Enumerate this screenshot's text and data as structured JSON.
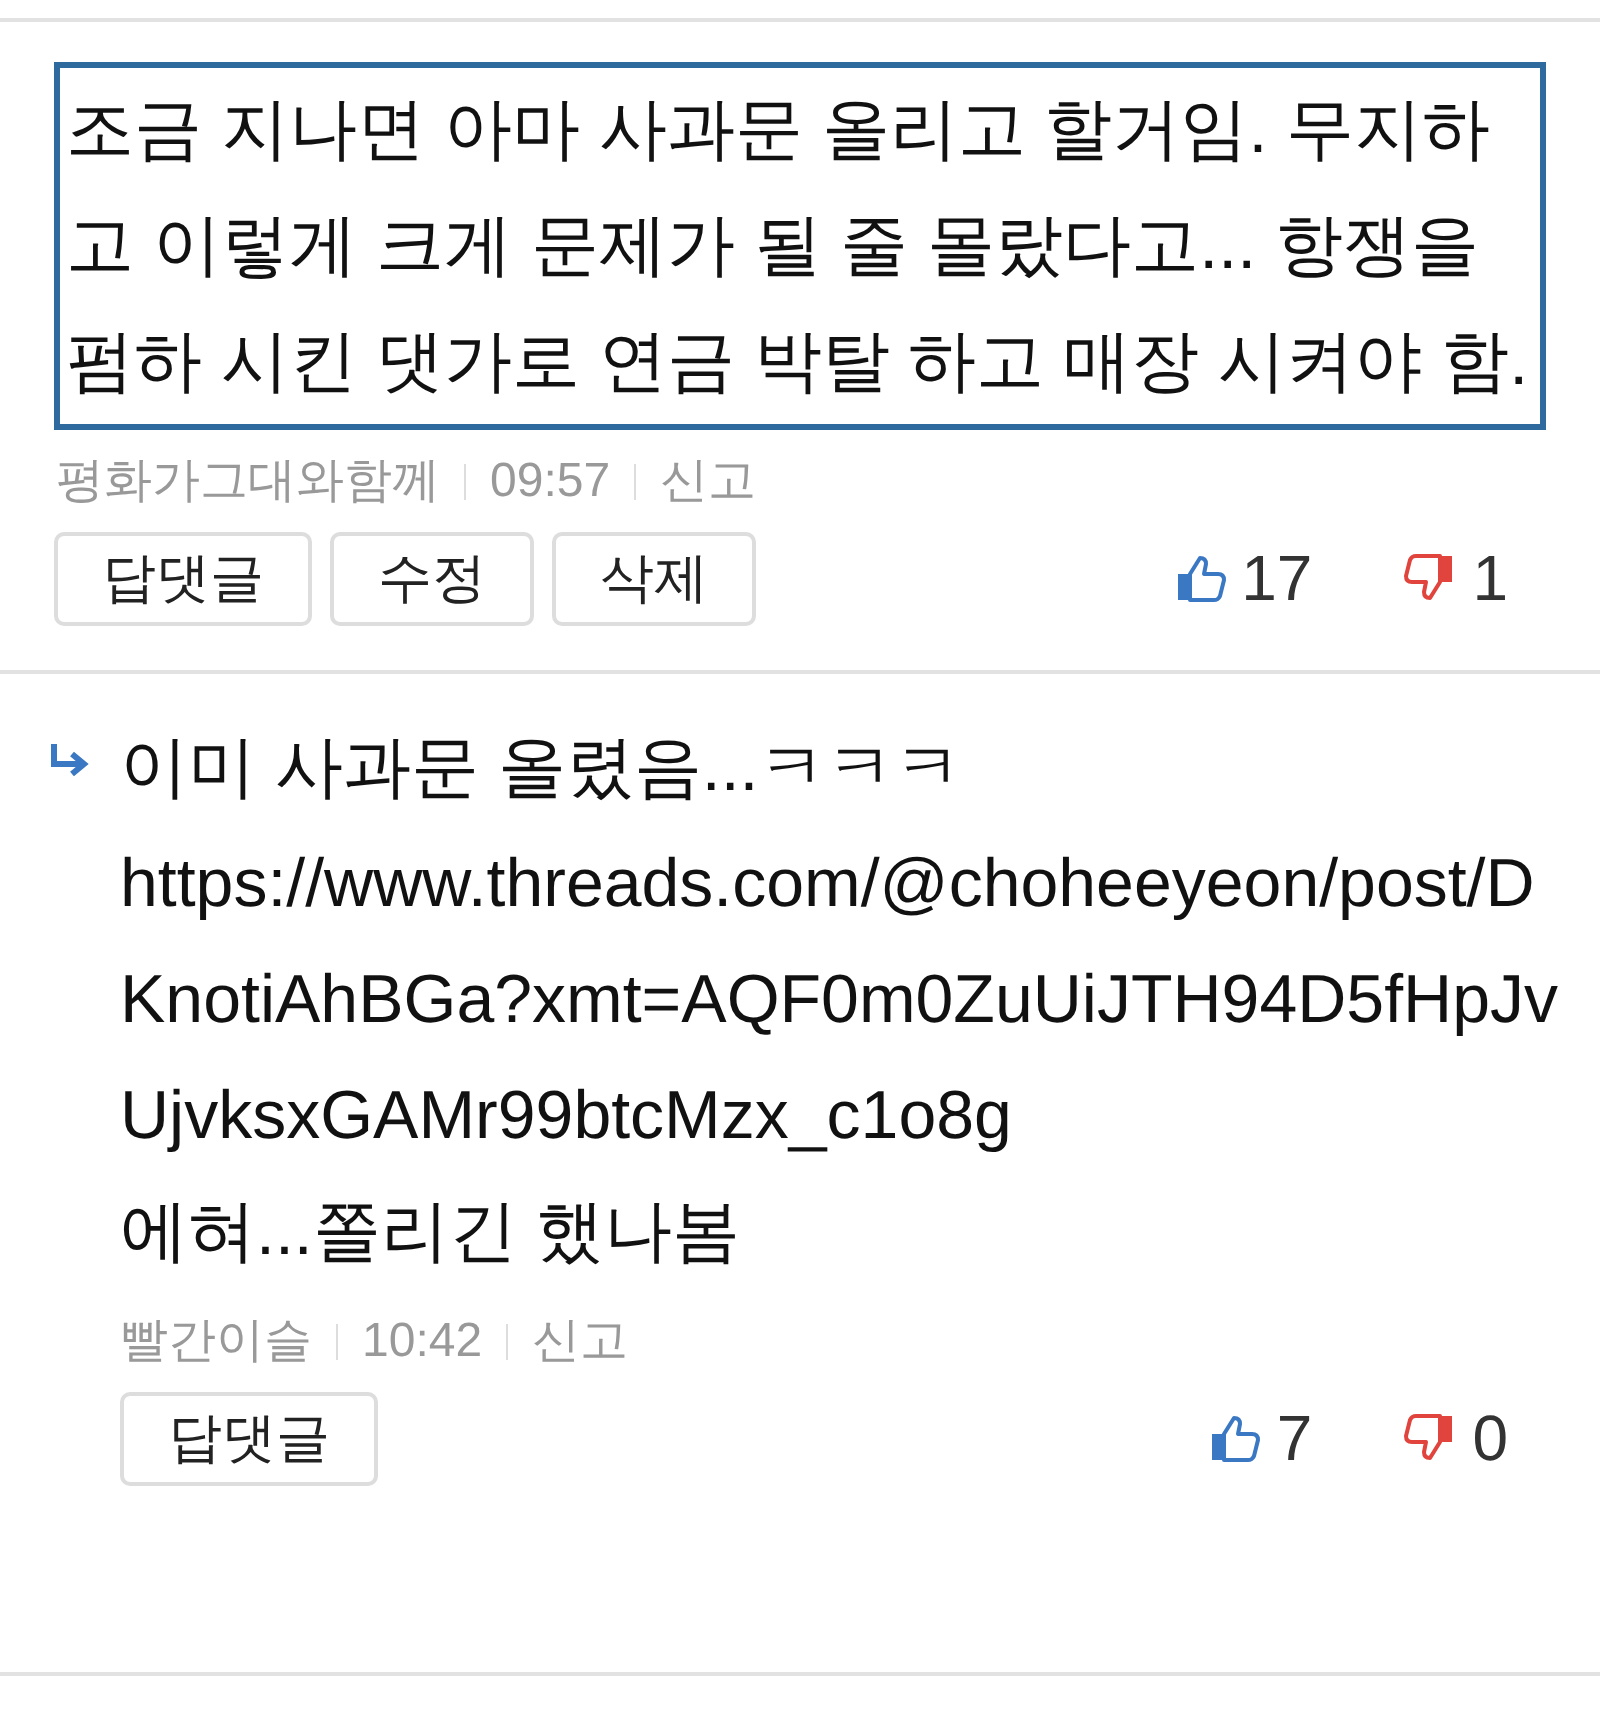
{
  "comments": [
    {
      "kind": "boxed",
      "lines": [
        "조금 지나면 아마 사과문 올리고 할거임. 무지하고 이렇게 크게 문제가 될 줄 몰랐다고... 항쟁을 펌하 시킨 댓가로 연금 박탈 하고 매장 시켜야 함."
      ],
      "author": "평화가그대와함께",
      "time": "09:57",
      "report": "신고",
      "buttons": [
        "답댓글",
        "수정",
        "삭제"
      ],
      "likes": "17",
      "dislikes": "1"
    },
    {
      "kind": "reply",
      "lines": [
        "이미 사과문 올렸음...ㅋㅋㅋ",
        "https://www.threads.com/@choheeyeon/post/DKnotiAhBGa?xmt=AQF0m0ZuUiJTH94D5fHpJvUjvksxGAMr99btcMzx_c1o8g",
        "에혀...쫄리긴 했나봄"
      ],
      "author": "빨간이슬",
      "time": "10:42",
      "report": "신고",
      "buttons": [
        "답댓글"
      ],
      "likes": "7",
      "dislikes": "0"
    }
  ]
}
